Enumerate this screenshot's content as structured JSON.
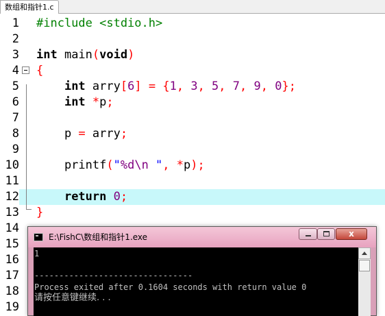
{
  "tab": {
    "label": "数组和指针1.c"
  },
  "editor": {
    "current_line": 12,
    "lines": [
      {
        "n": "1",
        "segments": [
          {
            "t": "#include <stdio.h>",
            "c": "pp"
          }
        ]
      },
      {
        "n": "2",
        "segments": []
      },
      {
        "n": "3",
        "segments": [
          {
            "t": "int",
            "c": "kw"
          },
          {
            "t": " main",
            "c": "fn"
          },
          {
            "t": "(",
            "c": "br"
          },
          {
            "t": "void",
            "c": "kw"
          },
          {
            "t": ")",
            "c": "br"
          }
        ]
      },
      {
        "n": "4",
        "segments": [
          {
            "t": "{",
            "c": "br"
          }
        ]
      },
      {
        "n": "5",
        "segments": [
          {
            "t": "    ",
            "c": "var"
          },
          {
            "t": "int",
            "c": "kw"
          },
          {
            "t": " arry",
            "c": "var"
          },
          {
            "t": "[",
            "c": "br"
          },
          {
            "t": "6",
            "c": "num"
          },
          {
            "t": "]",
            "c": "br"
          },
          {
            "t": " = ",
            "c": "op"
          },
          {
            "t": "{",
            "c": "br"
          },
          {
            "t": "1",
            "c": "num"
          },
          {
            "t": ", ",
            "c": "op"
          },
          {
            "t": "3",
            "c": "num"
          },
          {
            "t": ", ",
            "c": "op"
          },
          {
            "t": "5",
            "c": "num"
          },
          {
            "t": ", ",
            "c": "op"
          },
          {
            "t": "7",
            "c": "num"
          },
          {
            "t": ", ",
            "c": "op"
          },
          {
            "t": "9",
            "c": "num"
          },
          {
            "t": ", ",
            "c": "op"
          },
          {
            "t": "0",
            "c": "num"
          },
          {
            "t": "}",
            "c": "br"
          },
          {
            "t": ";",
            "c": "op"
          }
        ]
      },
      {
        "n": "6",
        "segments": [
          {
            "t": "    ",
            "c": "var"
          },
          {
            "t": "int",
            "c": "kw"
          },
          {
            "t": " ",
            "c": "var"
          },
          {
            "t": "*",
            "c": "op"
          },
          {
            "t": "p",
            "c": "var"
          },
          {
            "t": ";",
            "c": "op"
          }
        ]
      },
      {
        "n": "7",
        "segments": []
      },
      {
        "n": "8",
        "segments": [
          {
            "t": "    p ",
            "c": "var"
          },
          {
            "t": "=",
            "c": "op"
          },
          {
            "t": " arry",
            "c": "var"
          },
          {
            "t": ";",
            "c": "op"
          }
        ]
      },
      {
        "n": "9",
        "segments": []
      },
      {
        "n": "10",
        "segments": [
          {
            "t": "    printf",
            "c": "fn"
          },
          {
            "t": "(",
            "c": "br"
          },
          {
            "t": "\"",
            "c": "str"
          },
          {
            "t": "%d\\n",
            "c": "esc"
          },
          {
            "t": " \"",
            "c": "str"
          },
          {
            "t": ", ",
            "c": "op"
          },
          {
            "t": "*",
            "c": "op"
          },
          {
            "t": "p",
            "c": "var"
          },
          {
            "t": ")",
            "c": "br"
          },
          {
            "t": ";",
            "c": "op"
          }
        ]
      },
      {
        "n": "11",
        "segments": []
      },
      {
        "n": "12",
        "segments": [
          {
            "t": "    ",
            "c": "var"
          },
          {
            "t": "return",
            "c": "kw"
          },
          {
            "t": " ",
            "c": "var"
          },
          {
            "t": "0",
            "c": "num"
          },
          {
            "t": ";",
            "c": "op"
          }
        ]
      },
      {
        "n": "13",
        "segments": [
          {
            "t": "}",
            "c": "br"
          }
        ]
      },
      {
        "n": "14",
        "segments": []
      },
      {
        "n": "15",
        "segments": []
      },
      {
        "n": "16",
        "segments": []
      },
      {
        "n": "17",
        "segments": []
      },
      {
        "n": "18",
        "segments": []
      },
      {
        "n": "19",
        "segments": []
      }
    ]
  },
  "console": {
    "title": "E:\\FishC\\数组和指针1.exe",
    "close_glyph": "x",
    "output": [
      "1",
      "",
      "--------------------------------",
      "Process exited after 0.1604 seconds with return value 0",
      "请按任意键继续. . ."
    ]
  },
  "colors": {
    "current_line_bg": "#c8f8fa",
    "keyword": "#000000",
    "operator": "#ff0000",
    "number": "#800080",
    "string": "#0000ff",
    "preprocessor": "#008000",
    "console_frame": "#e7a2bf"
  },
  "icons": {
    "fold": "fold-minus-icon",
    "console": "console-app-icon"
  }
}
